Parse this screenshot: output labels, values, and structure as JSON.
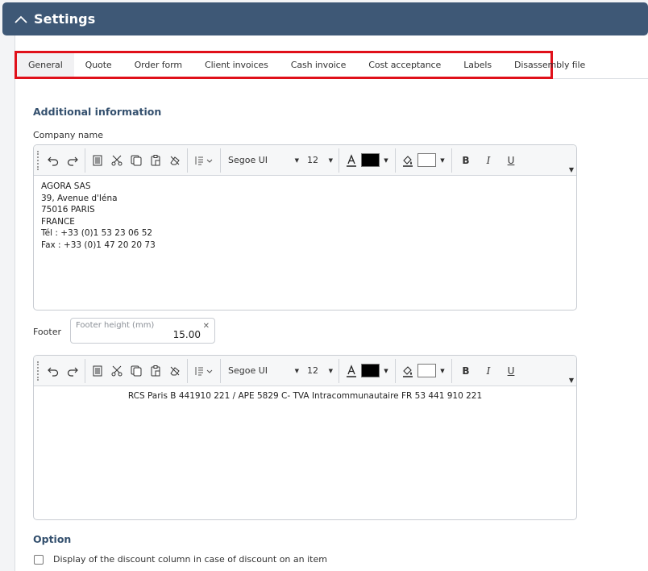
{
  "header": {
    "title": "Settings",
    "icon": "chevron-up-icon"
  },
  "tabs": [
    {
      "label": "General",
      "active": true
    },
    {
      "label": "Quote"
    },
    {
      "label": "Order form"
    },
    {
      "label": "Client invoices"
    },
    {
      "label": "Cash invoice"
    },
    {
      "label": "Cost acceptance"
    },
    {
      "label": "Labels"
    },
    {
      "label": "Disassembly file"
    }
  ],
  "additional": {
    "title": "Additional information",
    "company_label": "Company name",
    "company_lines": [
      "AGORA SAS",
      "39, Avenue d'Iéna",
      "75016 PARIS",
      "FRANCE",
      "Tél : +33 (0)1 53 23 06 52",
      "Fax : +33 (0)1 47 20 20 73"
    ]
  },
  "toolbar": {
    "font": "Segoe UI",
    "size": "12",
    "text_color": "#000000",
    "highlight_color": "#ffffff",
    "bold": "B",
    "italic": "I",
    "underline": "U"
  },
  "footer": {
    "label": "Footer",
    "height_placeholder": "Footer height (mm)",
    "height_value": "15.00",
    "text": "RCS Paris B 441910 221 / APE 5829 C- TVA Intracommunautaire FR 53 441 910 221"
  },
  "option": {
    "title": "Option",
    "discount_label": "Display of the discount column in case of discount on an item"
  }
}
